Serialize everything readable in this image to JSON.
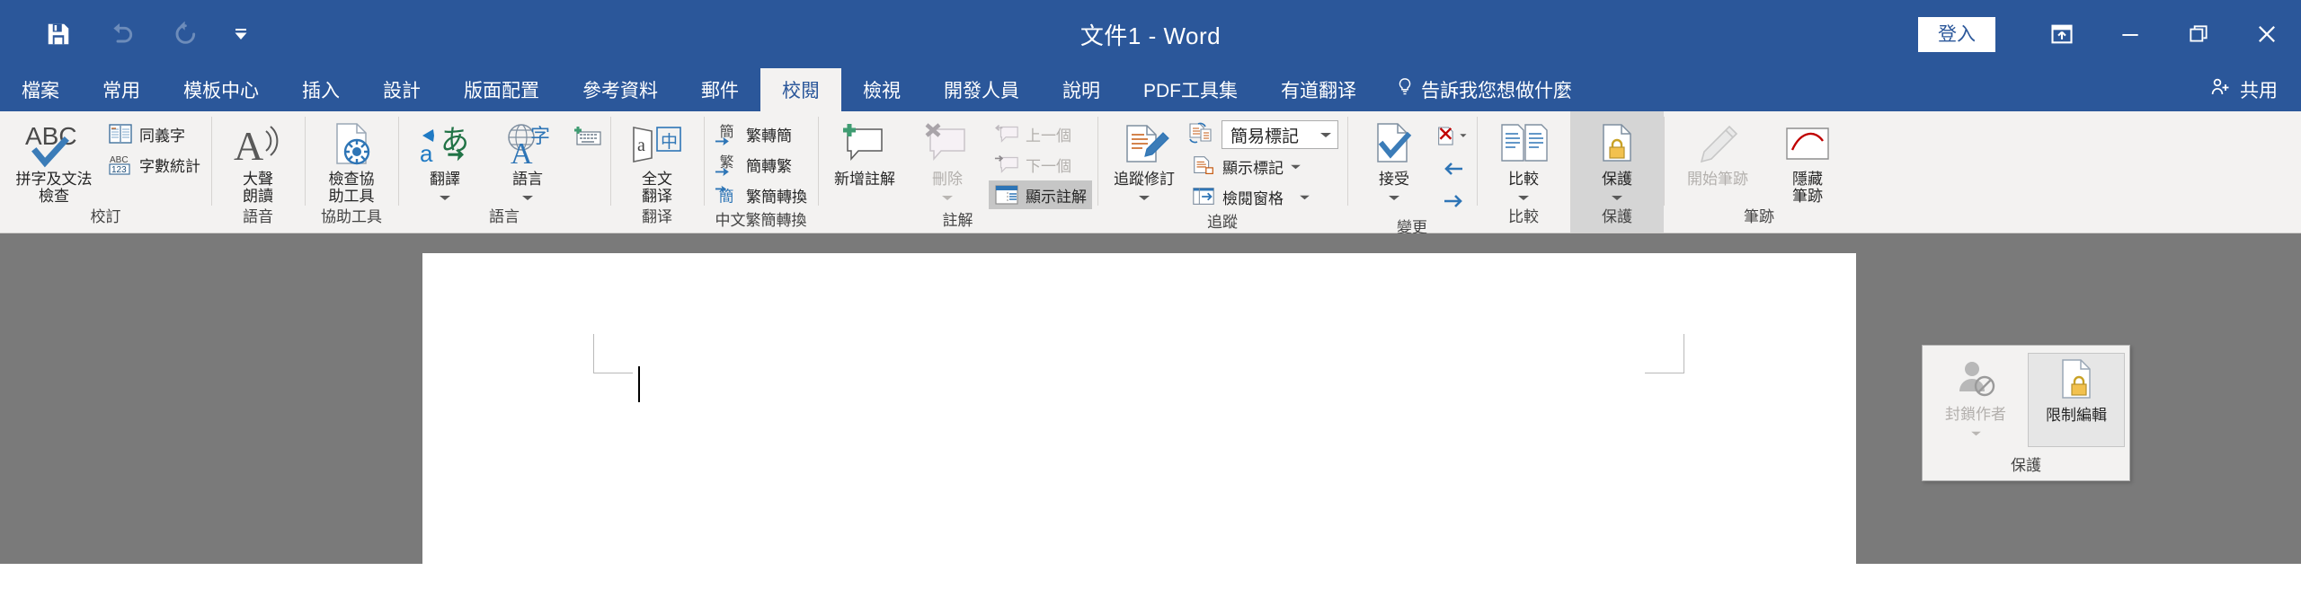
{
  "window": {
    "title": "文件1 - Word",
    "signin_label": "登入",
    "quick_access": [
      {
        "name": "save-icon",
        "label": "儲存檔案",
        "state": "enabled"
      },
      {
        "name": "undo-icon",
        "label": "復原",
        "state": "disabled"
      },
      {
        "name": "redo-icon",
        "label": "重做",
        "state": "disabled"
      },
      {
        "name": "customize-qat-icon",
        "label": "自訂快速存取工具列",
        "state": "enabled"
      }
    ],
    "controls": [
      {
        "name": "ribbon-display-options-icon",
        "label": "功能區顯示選項"
      },
      {
        "name": "minimize-icon",
        "label": "最小化"
      },
      {
        "name": "maximize-icon",
        "label": "最大化"
      },
      {
        "name": "close-icon",
        "label": "關閉"
      }
    ]
  },
  "tabs": [
    {
      "label": "檔案",
      "active": false
    },
    {
      "label": "常用",
      "active": false
    },
    {
      "label": "模板中心",
      "active": false
    },
    {
      "label": "插入",
      "active": false
    },
    {
      "label": "設計",
      "active": false
    },
    {
      "label": "版面配置",
      "active": false
    },
    {
      "label": "參考資料",
      "active": false
    },
    {
      "label": "郵件",
      "active": false
    },
    {
      "label": "校閱",
      "active": true
    },
    {
      "label": "檢視",
      "active": false
    },
    {
      "label": "開發人員",
      "active": false
    },
    {
      "label": "說明",
      "active": false
    },
    {
      "label": "PDF工具集",
      "active": false
    },
    {
      "label": "有道翻译",
      "active": false
    }
  ],
  "tellme": {
    "label": "告訴我您想做什麼",
    "icon": "lightbulb-icon"
  },
  "share": {
    "label": "共用",
    "icon": "person-add-icon"
  },
  "ribbon": {
    "groups": [
      {
        "name": "proofing",
        "label": "校訂",
        "items": [
          {
            "name": "spelling-grammar",
            "label": "拼字及文法\n檢查",
            "icon": "abc-check-icon",
            "size": "big",
            "state": "enabled"
          },
          {
            "name": "thesaurus",
            "label": "同義字",
            "icon": "book-icon",
            "size": "small",
            "state": "enabled"
          },
          {
            "name": "word-count",
            "label": "字數統計",
            "icon": "abc-123-icon",
            "size": "small",
            "state": "enabled"
          }
        ]
      },
      {
        "name": "speech",
        "label": "語音",
        "items": [
          {
            "name": "read-aloud",
            "label": "大聲\n朗讀",
            "icon": "read-aloud-icon",
            "size": "big",
            "state": "enabled"
          }
        ]
      },
      {
        "name": "accessibility",
        "label": "協助工具",
        "items": [
          {
            "name": "check-accessibility",
            "label": "檢查協\n助工具",
            "icon": "accessibility-icon",
            "size": "big",
            "state": "enabled"
          }
        ]
      },
      {
        "name": "language",
        "label": "語言",
        "items": [
          {
            "name": "translate",
            "label": "翻譯",
            "icon": "translate-icon",
            "size": "big",
            "state": "enabled",
            "dropdown": true
          },
          {
            "name": "language",
            "label": "語言",
            "icon": "language-globe-icon",
            "size": "big",
            "state": "enabled",
            "dropdown": true
          },
          {
            "name": "keyboard",
            "label": "",
            "icon": "keyboard-add-icon",
            "size": "icon",
            "state": "enabled"
          }
        ]
      },
      {
        "name": "fanyi",
        "label": "翻译",
        "items": [
          {
            "name": "full-text-translate",
            "label": "全文\n翻译",
            "icon": "a-zhong-icon",
            "size": "big",
            "state": "enabled"
          }
        ]
      },
      {
        "name": "chinese-conversion",
        "label": "中文繁簡轉換",
        "items": [
          {
            "name": "trad-to-simp",
            "label": "繁轉簡",
            "icon": "jian-arrow-icon",
            "size": "small",
            "state": "enabled"
          },
          {
            "name": "simp-to-trad",
            "label": "簡轉繁",
            "icon": "fan-arrow-icon",
            "size": "small",
            "state": "enabled"
          },
          {
            "name": "conversion-options",
            "label": "繁簡轉換",
            "icon": "jian-convert-icon",
            "size": "small",
            "state": "enabled"
          }
        ]
      },
      {
        "name": "comments",
        "label": "註解",
        "items": [
          {
            "name": "new-comment",
            "label": "新增註解",
            "icon": "comment-add-icon",
            "size": "big",
            "state": "enabled"
          },
          {
            "name": "delete-comment",
            "label": "刪除",
            "icon": "comment-delete-icon",
            "size": "big",
            "state": "disabled",
            "dropdown": true
          },
          {
            "name": "previous-comment",
            "label": "上一個",
            "icon": "comment-prev-icon",
            "size": "small",
            "state": "disabled"
          },
          {
            "name": "next-comment",
            "label": "下一個",
            "icon": "comment-next-icon",
            "size": "small",
            "state": "disabled"
          },
          {
            "name": "show-comments",
            "label": "顯示註解",
            "icon": "show-comments-icon",
            "size": "small",
            "state": "selected"
          }
        ]
      },
      {
        "name": "tracking",
        "label": "追蹤",
        "has_dialog_launcher": true,
        "items": [
          {
            "name": "track-changes",
            "label": "追蹤修訂",
            "icon": "track-changes-icon",
            "size": "big",
            "state": "enabled",
            "dropdown": true
          },
          {
            "name": "markup-display",
            "label": "簡易標記",
            "icon": "markup-display-icon",
            "size": "combo",
            "state": "enabled"
          },
          {
            "name": "show-markup",
            "label": "顯示標記",
            "icon": "show-markup-icon",
            "size": "small",
            "state": "enabled",
            "dropdown": true
          },
          {
            "name": "reviewing-pane",
            "label": "檢閱窗格",
            "icon": "reviewing-pane-icon",
            "size": "small",
            "state": "enabled",
            "dropdown": true
          }
        ]
      },
      {
        "name": "changes",
        "label": "變更",
        "items": [
          {
            "name": "accept",
            "label": "接受",
            "icon": "accept-icon",
            "size": "big",
            "state": "enabled",
            "dropdown": true
          },
          {
            "name": "reject",
            "label": "拒絕",
            "icon": "reject-icon",
            "size": "icon",
            "state": "enabled",
            "dropdown": true
          },
          {
            "name": "previous-change",
            "label": "前一個",
            "icon": "arrow-left-icon",
            "size": "icon",
            "state": "enabled"
          },
          {
            "name": "next-change",
            "label": "下一個",
            "icon": "arrow-right-icon",
            "size": "icon",
            "state": "enabled"
          }
        ]
      },
      {
        "name": "compare",
        "label": "比較",
        "items": [
          {
            "name": "compare",
            "label": "比較",
            "icon": "compare-icon",
            "size": "big",
            "state": "enabled",
            "dropdown": true
          }
        ]
      },
      {
        "name": "protect",
        "label": "保護",
        "active": true,
        "items": [
          {
            "name": "protect",
            "label": "保護",
            "icon": "protect-lock-icon",
            "size": "big",
            "state": "open",
            "dropdown": true
          }
        ]
      },
      {
        "name": "ink",
        "label": "筆跡",
        "items": [
          {
            "name": "start-inking",
            "label": "開始筆跡",
            "icon": "pen-icon",
            "size": "big",
            "state": "disabled"
          },
          {
            "name": "hide-ink",
            "label": "隱藏\n筆跡",
            "icon": "hide-ink-icon",
            "size": "big",
            "state": "enabled"
          }
        ]
      }
    ]
  },
  "protect_dropdown": {
    "group_label": "保護",
    "items": [
      {
        "name": "block-authors",
        "label": "封鎖作者",
        "icon": "block-author-icon",
        "state": "disabled",
        "dropdown": true
      },
      {
        "name": "restrict-editing",
        "label": "限制編輯",
        "icon": "restrict-editing-icon",
        "state": "hover"
      }
    ]
  },
  "document": {
    "cursor_visible": true,
    "page_background": "#ffffff",
    "canvas_background": "#7a7a7a"
  },
  "colors": {
    "brand": "#2b579a",
    "ribbon_bg": "#f3f2f1",
    "accent_blue": "#2b7cd3",
    "disabled_text": "#b3b0ad"
  }
}
